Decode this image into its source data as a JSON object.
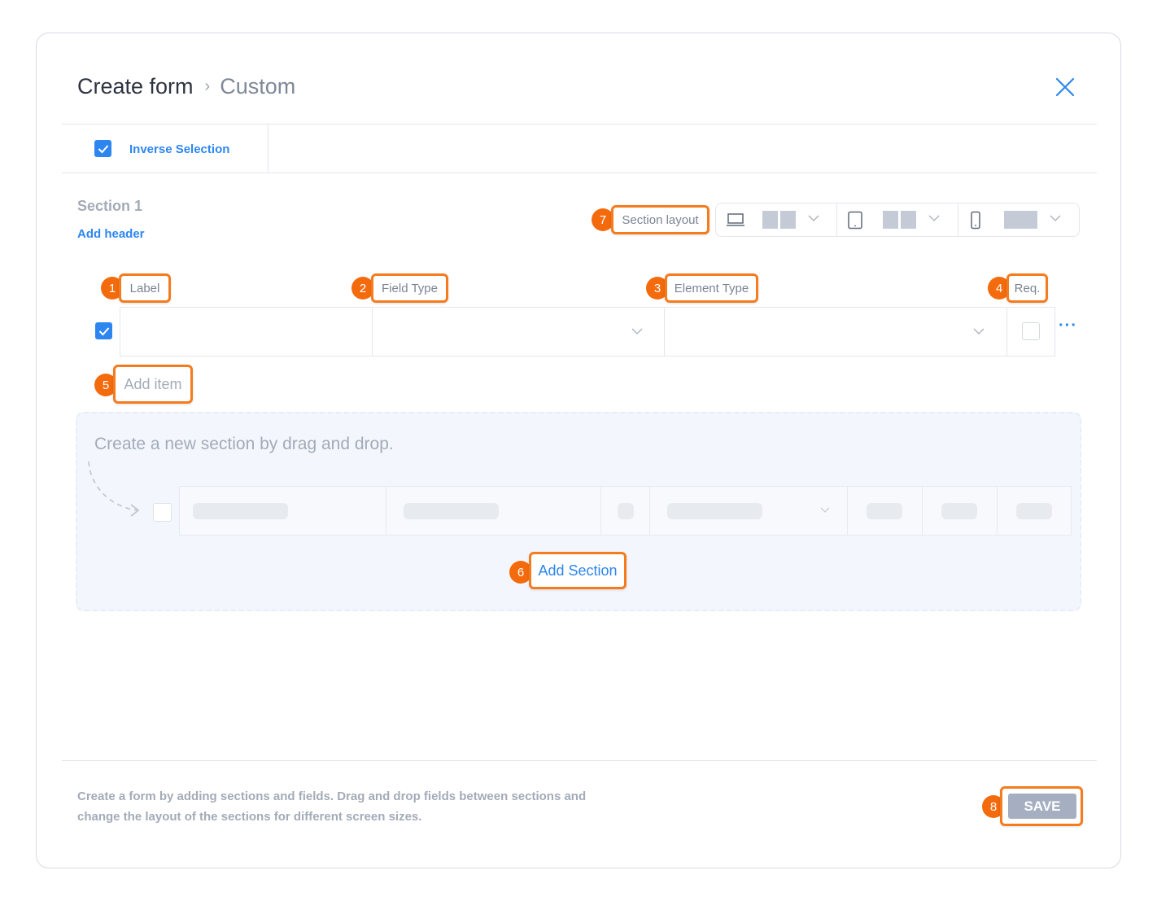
{
  "dialog": {
    "title": "Create form",
    "breadcrumb_current": "Custom",
    "close_icon": "close-icon"
  },
  "toolbar": {
    "inverse_selection_label": "Inverse Selection",
    "inverse_selection_checked": true
  },
  "section": {
    "title": "Section 1",
    "add_header_label": "Add header",
    "layout_label": "Section layout",
    "layouts": [
      {
        "device": "laptop-icon",
        "columns": 2
      },
      {
        "device": "tablet-icon",
        "columns": 2
      },
      {
        "device": "phone-icon",
        "columns": 1
      }
    ]
  },
  "columns": {
    "label": "Label",
    "field_type": "Field Type",
    "element_type": "Element Type",
    "required": "Req."
  },
  "row": {
    "checked": true,
    "label_value": "",
    "field_type_value": "",
    "element_type_value": "",
    "required": false
  },
  "add_item_label": "Add item",
  "drop_zone": {
    "hint": "Create a new section by drag and drop.",
    "add_section_label": "Add Section"
  },
  "footer": {
    "help_text": "Create a form by adding sections and fields. Drag and drop fields between sections and change the layout of the sections for different screen sizes.",
    "save_label": "SAVE"
  },
  "callouts": [
    "1",
    "2",
    "3",
    "4",
    "5",
    "6",
    "7",
    "8"
  ],
  "colors": {
    "accent": "#2d86f0",
    "callout": "#f46b0d",
    "save_disabled": "#a6afc1"
  }
}
